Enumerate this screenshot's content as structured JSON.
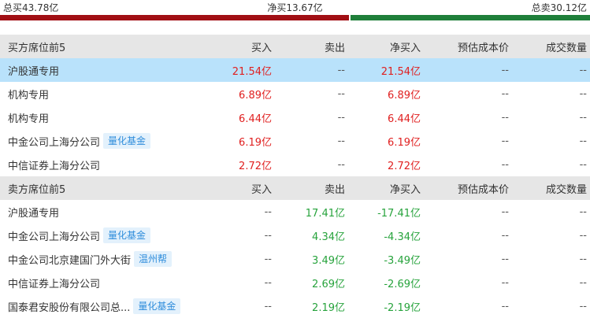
{
  "summary": {
    "total_buy": "总买43.78亿",
    "net_buy": "净买13.67亿",
    "total_sell": "总卖30.12亿",
    "buy_share": 0.592
  },
  "colors": {
    "buy_bar": "#a10f14",
    "sell_bar": "#1f7f3a",
    "highlight": "#b9e2fb",
    "up": "#e02020",
    "down": "#27a33c"
  },
  "columns_buy": [
    "买方席位前5",
    "买入",
    "卖出",
    "净买入",
    "预估成本价",
    "成交数量"
  ],
  "buy_rows": [
    {
      "name": "沪股通专用",
      "tag": "",
      "buy": "21.54亿",
      "sell": "--",
      "net": "21.54亿",
      "cost": "--",
      "vol": "--"
    },
    {
      "name": "机构专用",
      "tag": "",
      "buy": "6.89亿",
      "sell": "--",
      "net": "6.89亿",
      "cost": "--",
      "vol": "--"
    },
    {
      "name": "机构专用",
      "tag": "",
      "buy": "6.44亿",
      "sell": "--",
      "net": "6.44亿",
      "cost": "--",
      "vol": "--"
    },
    {
      "name": "中金公司上海分公司",
      "tag": "量化基金",
      "buy": "6.19亿",
      "sell": "--",
      "net": "6.19亿",
      "cost": "--",
      "vol": "--"
    },
    {
      "name": "中信证券上海分公司",
      "tag": "",
      "buy": "2.72亿",
      "sell": "--",
      "net": "2.72亿",
      "cost": "--",
      "vol": "--"
    }
  ],
  "columns_sell": [
    "卖方席位前5",
    "买入",
    "卖出",
    "净买入",
    "预估成本价",
    "成交数量"
  ],
  "sell_rows": [
    {
      "name": "沪股通专用",
      "tag": "",
      "buy": "--",
      "sell": "17.41亿",
      "net": "-17.41亿",
      "cost": "--",
      "vol": "--"
    },
    {
      "name": "中金公司上海分公司",
      "tag": "量化基金",
      "buy": "--",
      "sell": "4.34亿",
      "net": "-4.34亿",
      "cost": "--",
      "vol": "--"
    },
    {
      "name": "中金公司北京建国门外大街",
      "tag": "温州帮",
      "buy": "--",
      "sell": "3.49亿",
      "net": "-3.49亿",
      "cost": "--",
      "vol": "--"
    },
    {
      "name": "中信证券上海分公司",
      "tag": "",
      "buy": "--",
      "sell": "2.69亿",
      "net": "-2.69亿",
      "cost": "--",
      "vol": "--"
    },
    {
      "name": "国泰君安股份有限公司总...",
      "tag": "量化基金",
      "buy": "--",
      "sell": "2.19亿",
      "net": "-2.19亿",
      "cost": "--",
      "vol": "--"
    }
  ]
}
